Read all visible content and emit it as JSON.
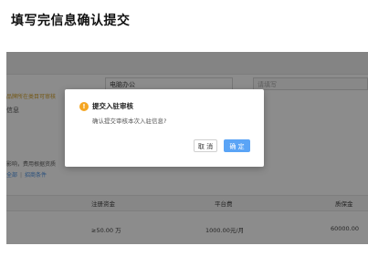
{
  "page_title": "填写完信息确认提交",
  "background_form": {
    "field_value_1": "电脑办公",
    "field_placeholder_2": "请填写",
    "warning_text": "品牌所在类目可审核",
    "row_label": "信息",
    "note_text": "影响，费用根据资质",
    "links": [
      "全部",
      "招商条件"
    ],
    "table": {
      "headers": [
        "注册资金",
        "平台费",
        "质保金"
      ],
      "row": [
        "≥50.00 万",
        "1000.00元/月",
        "60000.00"
      ]
    }
  },
  "dialog": {
    "icon": "!",
    "title": "提交入驻审核",
    "message": "确认提交审核本次入驻信息?",
    "cancel_label": "取 消",
    "confirm_label": "确 定"
  },
  "colors": {
    "overlay": "rgba(0,0,0,0.45)",
    "warning_icon": "#f5a623",
    "primary_button": "#5aa4f6",
    "link": "#4a90e2"
  }
}
